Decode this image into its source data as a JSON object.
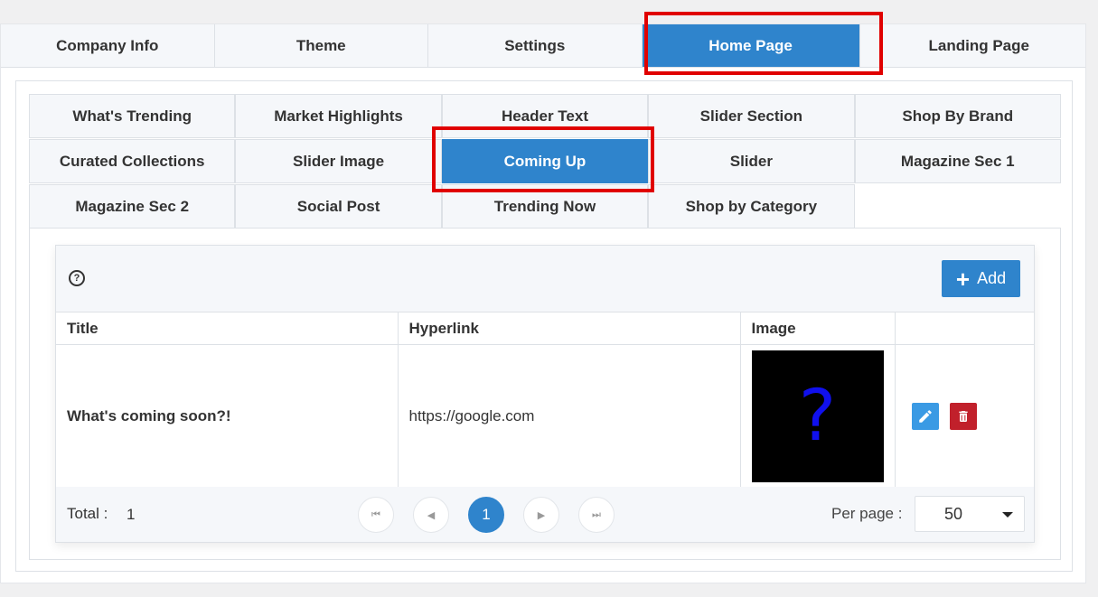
{
  "main_tabs": [
    {
      "label": "Company Info"
    },
    {
      "label": "Theme"
    },
    {
      "label": "Settings"
    },
    {
      "label": "Home Page",
      "active": true
    },
    {
      "label": "Landing Page"
    }
  ],
  "sub_tabs": [
    [
      "What's Trending",
      "Market Highlights",
      "Header Text",
      "Slider Section",
      "Shop By Brand"
    ],
    [
      "Curated Collections",
      "Slider Image",
      "Coming Up",
      "Slider",
      "Magazine Sec 1"
    ],
    [
      "Magazine Sec 2",
      "Social Post",
      "Trending Now",
      "Shop by Category"
    ]
  ],
  "active_sub_tab": "Coming Up",
  "toolbar": {
    "help_icon": "question-circle-icon",
    "add_label": "Add"
  },
  "table": {
    "columns": [
      "Title",
      "Hyperlink",
      "Image",
      ""
    ],
    "rows": [
      {
        "title": "What's coming soon?!",
        "hyperlink": "https://google.com",
        "image_glyph": "?"
      }
    ]
  },
  "footer": {
    "total_label": "Total :",
    "total_value": "1",
    "current_page": "1",
    "per_page_label": "Per page :",
    "per_page_value": "50"
  },
  "colors": {
    "accent": "#2f84cc",
    "highlight": "#e00000",
    "delete": "#c1202b",
    "edit": "#3a9ae4"
  }
}
